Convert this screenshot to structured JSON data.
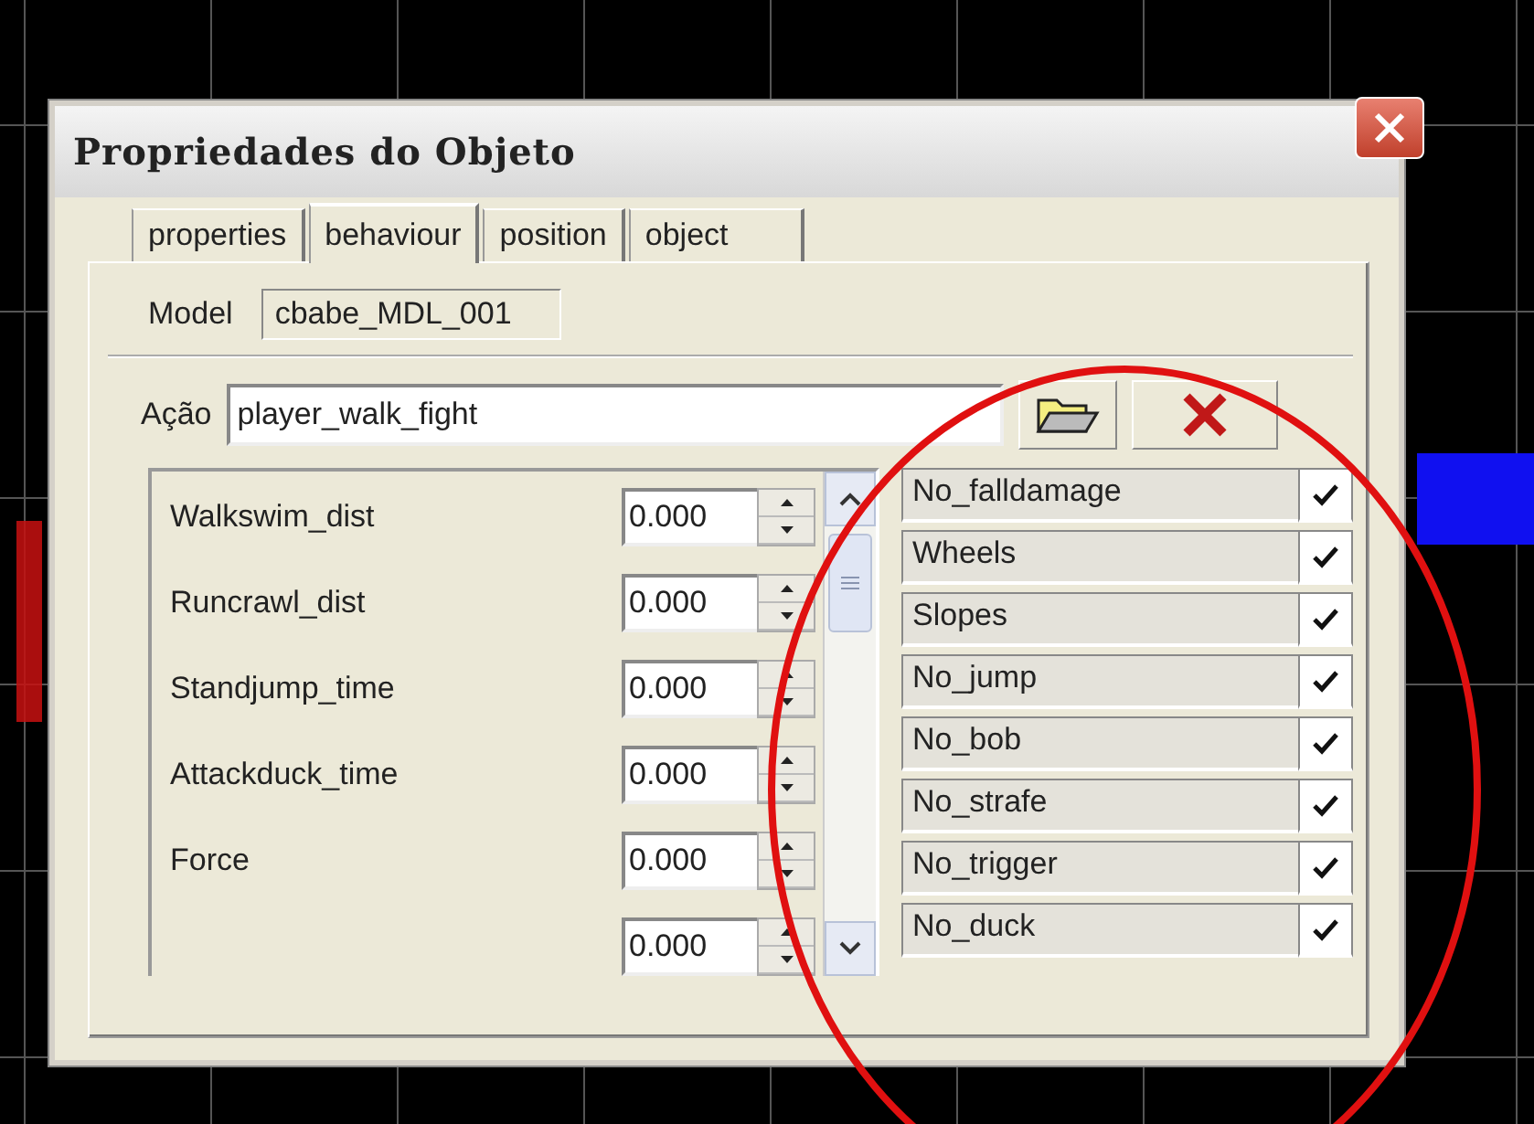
{
  "window": {
    "title": "Propriedades do Objeto"
  },
  "tabs": [
    {
      "label": "properties",
      "selected": false
    },
    {
      "label": "behaviour",
      "selected": true
    },
    {
      "label": "position",
      "selected": false
    },
    {
      "label": "object",
      "selected": false
    }
  ],
  "model": {
    "label": "Model",
    "value": "cbabe_MDL_001"
  },
  "action": {
    "label": "Ação",
    "value": "player_walk_fight"
  },
  "parameters": [
    {
      "label": "Walkswim_dist",
      "value": "0.000"
    },
    {
      "label": "Runcrawl_dist",
      "value": "0.000"
    },
    {
      "label": "Standjump_time",
      "value": "0.000"
    },
    {
      "label": "Attackduck_time",
      "value": "0.000"
    },
    {
      "label": "Force",
      "value": "0.000"
    },
    {
      "value": "0.000"
    }
  ],
  "flags": [
    {
      "label": "No_falldamage",
      "checked": true
    },
    {
      "label": "Wheels",
      "checked": true
    },
    {
      "label": "Slopes",
      "checked": true
    },
    {
      "label": "No_jump",
      "checked": true
    },
    {
      "label": "No_bob",
      "checked": true
    },
    {
      "label": "No_strafe",
      "checked": true
    },
    {
      "label": "No_trigger",
      "checked": true
    },
    {
      "label": "No_duck",
      "checked": true
    }
  ]
}
